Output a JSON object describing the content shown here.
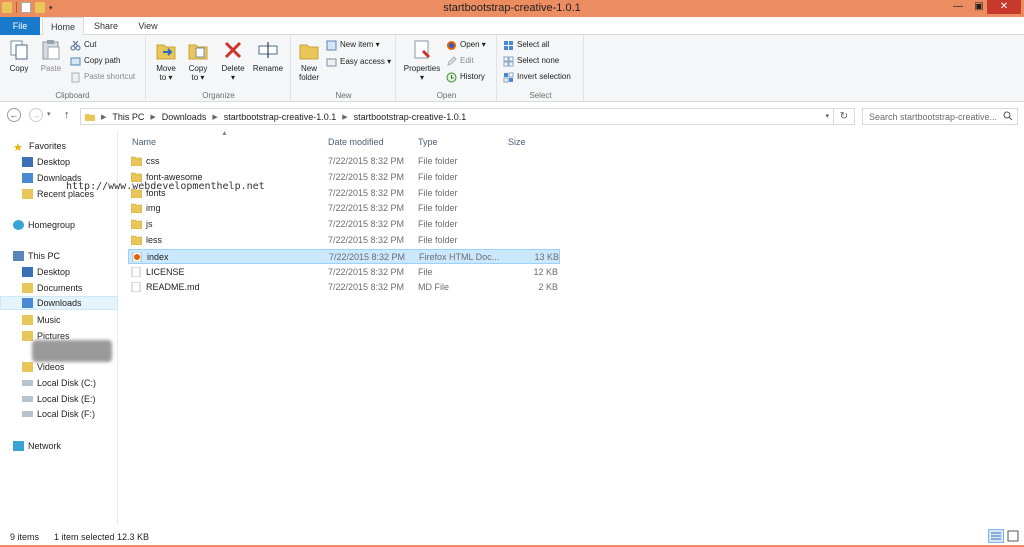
{
  "window": {
    "title": "startbootstrap-creative-1.0.1"
  },
  "tabs": {
    "file": "File",
    "home": "Home",
    "share": "Share",
    "view": "View"
  },
  "ribbon": {
    "clipboard": {
      "label": "Clipboard",
      "copy": "Copy",
      "paste": "Paste",
      "cut": "Cut",
      "copy_path": "Copy path",
      "paste_shortcut": "Paste shortcut"
    },
    "organize": {
      "label": "Organize",
      "move_to": "Move",
      "move_to2": "to ▾",
      "copy_to": "Copy",
      "copy_to2": "to ▾",
      "delete": "Delete",
      "delete2": "▾",
      "rename": "Rename"
    },
    "new": {
      "label": "New",
      "new_folder": "New",
      "new_folder2": "folder",
      "new_item": "New item ▾",
      "easy_access": "Easy access ▾"
    },
    "open": {
      "label": "Open",
      "properties": "Properties",
      "properties2": "▾",
      "open": "Open ▾",
      "edit": "Edit",
      "history": "History"
    },
    "select": {
      "label": "Select",
      "select_all": "Select all",
      "select_none": "Select none",
      "invert": "Invert selection"
    }
  },
  "address": {
    "crumbs": [
      "This PC",
      "Downloads",
      "startbootstrap-creative-1.0.1",
      "startbootstrap-creative-1.0.1"
    ],
    "search_placeholder": "Search startbootstrap-creative..."
  },
  "navpane": {
    "favorites": "Favorites",
    "fav_items": [
      "Desktop",
      "Downloads",
      "Recent places"
    ],
    "homegroup": "Homegroup",
    "thispc": "This PC",
    "pc_items": [
      "Desktop",
      "Documents",
      "Downloads",
      "Music",
      "Pictures",
      "Videos",
      "Local Disk (C:)",
      "Local Disk (E:)",
      "Local Disk (F:)"
    ],
    "network": "Network"
  },
  "columns": {
    "name": "Name",
    "date": "Date modified",
    "type": "Type",
    "size": "Size"
  },
  "files": [
    {
      "name": "css",
      "date": "7/22/2015 8:32 PM",
      "type": "File folder",
      "size": ""
    },
    {
      "name": "font-awesome",
      "date": "7/22/2015 8:32 PM",
      "type": "File folder",
      "size": ""
    },
    {
      "name": "fonts",
      "date": "7/22/2015 8:32 PM",
      "type": "File folder",
      "size": ""
    },
    {
      "name": "img",
      "date": "7/22/2015 8:32 PM",
      "type": "File folder",
      "size": ""
    },
    {
      "name": "js",
      "date": "7/22/2015 8:32 PM",
      "type": "File folder",
      "size": ""
    },
    {
      "name": "less",
      "date": "7/22/2015 8:32 PM",
      "type": "File folder",
      "size": ""
    },
    {
      "name": "index",
      "date": "7/22/2015 8:32 PM",
      "type": "Firefox HTML Doc...",
      "size": "13 KB"
    },
    {
      "name": "LICENSE",
      "date": "7/22/2015 8:32 PM",
      "type": "File",
      "size": "12 KB"
    },
    {
      "name": "README.md",
      "date": "7/22/2015 8:32 PM",
      "type": "MD File",
      "size": "2 KB"
    }
  ],
  "watermark": "http://www.webdevelopmenthelp.net",
  "status": {
    "count": "9 items",
    "selected": "1 item selected",
    "size": "12.3 KB"
  },
  "colors": {
    "titlebar": "#ec8d61",
    "file_tab": "#1979ca",
    "selection": "#cce8ff",
    "close": "#c7392b"
  }
}
